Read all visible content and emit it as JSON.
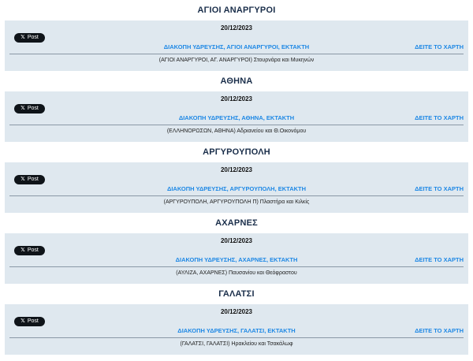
{
  "xpost_label": "Post",
  "sections": [
    {
      "area": "ΑΓΙΟΙ ΑΝΑΡΓΥΡΟΙ",
      "date": "20/12/2023",
      "notice": "ΔΙΑΚΟΠΗ ΥΔΡΕΥΣΗΣ, ΑΓΙΟΙ ΑΝΑΡΓΥΡΟΙ, ΕΚΤΑΚΤΗ",
      "map_link": "ΔΕΙΤΕ ΤΟ ΧΑΡΤΗ",
      "street": "(ΑΓΙΟΙ ΑΝΑΡΓΥΡΟΙ, ΑΓ. ΑΝΑΡΓΥΡΟΙ) Στουρνάρα και Μυκηνών"
    },
    {
      "area": "ΑΘΗΝΑ",
      "date": "20/12/2023",
      "notice": "ΔΙΑΚΟΠΗ ΥΔΡΕΥΣΗΣ, ΑΘΗΝΑ, ΕΚΤΑΚΤΗ",
      "map_link": "ΔΕΙΤΕ ΤΟ ΧΑΡΤΗ",
      "street": "(ΕΛΛΗΝΟΡΩΣΩΝ, ΑΘΗΝΑ) Αδριανείου και Θ.Οικονόμου"
    },
    {
      "area": "ΑΡΓΥΡΟΥΠΟΛΗ",
      "date": "20/12/2023",
      "notice": "ΔΙΑΚΟΠΗ ΥΔΡΕΥΣΗΣ, ΑΡΓΥΡΟΥΠΟΛΗ, ΕΚΤΑΚΤΗ",
      "map_link": "ΔΕΙΤΕ ΤΟ ΧΑΡΤΗ",
      "street": "(ΑΡΓΥΡΟΥΠΟΛΗ, ΑΡΓΥΡΟΥΠΟΛΗ Π) Πλαστήρα και Κιλκίς"
    },
    {
      "area": "ΑΧΑΡΝΕΣ",
      "date": "20/12/2023",
      "notice": "ΔΙΑΚΟΠΗ ΥΔΡΕΥΣΗΣ, ΑΧΑΡΝΕΣ, ΕΚΤΑΚΤΗ",
      "map_link": "ΔΕΙΤΕ ΤΟ ΧΑΡΤΗ",
      "street": "(ΑΥΛΙΖΑ, ΑΧΑΡΝΕΣ) Παυσανίου και Θεόφραστου"
    },
    {
      "area": "ΓΑΛΑΤΣΙ",
      "date": "20/12/2023",
      "notice": "ΔΙΑΚΟΠΗ ΥΔΡΕΥΣΗΣ, ΓΑΛΑΤΣΙ, ΕΚΤΑΚΤΗ",
      "map_link": "ΔΕΙΤΕ ΤΟ ΧΑΡΤΗ",
      "street": "(ΓΑΛΑΤΣΙ, ΓΑΛΑΤΣΙ) Ηρακλείου και Τσακάλωφ"
    }
  ]
}
